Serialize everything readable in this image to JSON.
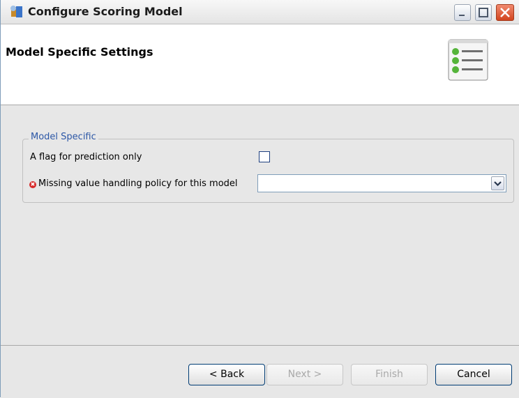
{
  "window": {
    "title": "Configure Scoring Model",
    "icon": "config-app-icon"
  },
  "titlebar_buttons": {
    "minimize": "minimize-icon",
    "maximize": "maximize-icon",
    "close": "close-icon"
  },
  "header": {
    "title": "Model Specific Settings",
    "icon": "settings-list-icon"
  },
  "group": {
    "legend": "Model Specific",
    "flag_label": "A flag for prediction only",
    "policy_label": "Missing value handling policy for this model",
    "policy_value": "",
    "flag_checked": false
  },
  "buttons": {
    "back": "< Back",
    "next": "Next >",
    "finish": "Finish",
    "cancel": "Cancel"
  },
  "colors": {
    "legend": "#2c57a6",
    "error": "#d62a2a",
    "close_button": "#d2441e"
  }
}
